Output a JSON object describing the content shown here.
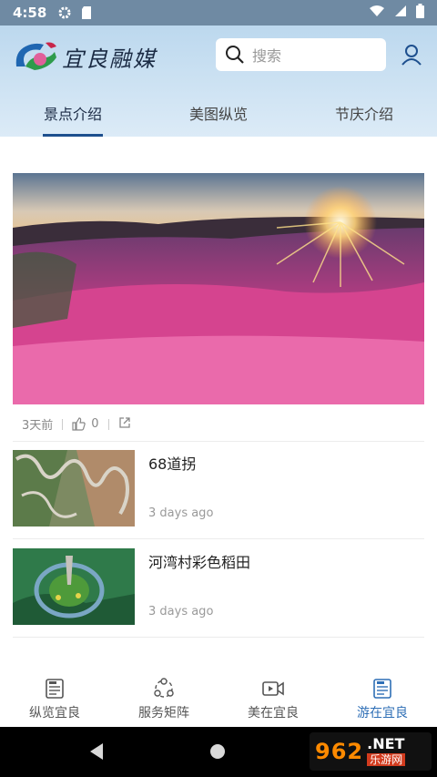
{
  "status_bar": {
    "time": "4:58"
  },
  "header": {
    "logo_text": "宜良融媒",
    "search": {
      "placeholder": "搜索"
    },
    "tabs": [
      {
        "label": "景点介绍",
        "active": true
      },
      {
        "label": "美图纵览",
        "active": false
      },
      {
        "label": "节庆介绍",
        "active": false
      }
    ]
  },
  "feature": {
    "time": "3天前",
    "likes": "0"
  },
  "news": [
    {
      "title": "68道拐",
      "time": "3 days ago"
    },
    {
      "title": "河湾村彩色稻田",
      "time": "3 days ago"
    }
  ],
  "bottom_nav": [
    {
      "label": "纵览宜良",
      "icon": "news-icon",
      "active": false
    },
    {
      "label": "服务矩阵",
      "icon": "network-icon",
      "active": false
    },
    {
      "label": "美在宜良",
      "icon": "video-icon",
      "active": false
    },
    {
      "label": "游在宜良",
      "icon": "news-icon",
      "active": true
    }
  ],
  "watermark": {
    "number": "962",
    "net": ".NET",
    "cn": "乐游网"
  },
  "colors": {
    "accent": "#2f6fb6",
    "tab_underline": "#1d4f8e",
    "status_bar": "#6f8aa3"
  }
}
